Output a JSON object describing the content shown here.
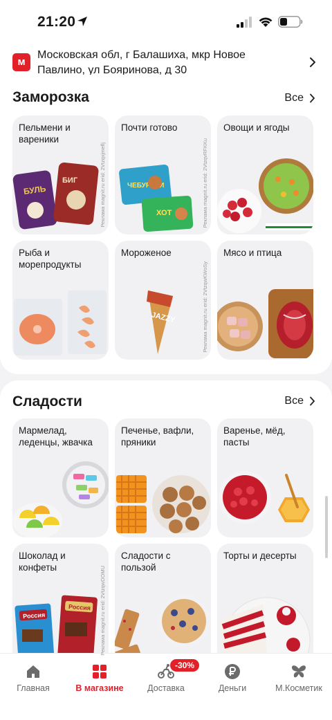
{
  "status_bar": {
    "time": "21:20"
  },
  "header": {
    "logo_letter": "м",
    "address": "Московская обл, г Балашиха, мкр Новое Павлино, ул Бояринова, д 30"
  },
  "sections": [
    {
      "title": "Заморозка",
      "all_label": "Все",
      "tiles": [
        {
          "label": "Пельмени и вареники",
          "ad": "Реклама magnit.ru erid: 2Vtzqxjmeflj"
        },
        {
          "label": "Почти готово",
          "ad": "Реклама magnit.ru erid: 2VtzqvRFKKu"
        },
        {
          "label": "Овощи и ягоды"
        },
        {
          "label": "Рыба и морепродукты"
        },
        {
          "label": "Мороженое",
          "ad": "Реклама magnit.ru erid: 2VtzqwKWoSy"
        },
        {
          "label": "Мясо и птица"
        }
      ]
    },
    {
      "title": "Сладости",
      "all_label": "Все",
      "tiles": [
        {
          "label": "Мармелад, леденцы, жвачка"
        },
        {
          "label": "Печенье, вафли, пряники"
        },
        {
          "label": "Варенье, мёд, пасты"
        },
        {
          "label": "Шоколад и конфеты",
          "ad": "Реклама magnit.ru erid: 2VtzqwDOMU"
        },
        {
          "label": "Сладости с пользой"
        },
        {
          "label": "Торты и десерты"
        }
      ]
    }
  ],
  "tabbar": {
    "items": [
      {
        "label": "Главная",
        "icon": "home-icon"
      },
      {
        "label": "В магазине",
        "icon": "store-icon",
        "active": true
      },
      {
        "label": "Доставка",
        "icon": "courier-icon"
      },
      {
        "label": "Деньги",
        "icon": "ruble-icon"
      },
      {
        "label": "М.Косметик",
        "icon": "butterfly-icon"
      }
    ],
    "delivery_badge": "-30%"
  },
  "colors": {
    "accent": "#e2202a",
    "tile_bg": "#f1f1f3",
    "page_bg": "#f3f3f5"
  }
}
